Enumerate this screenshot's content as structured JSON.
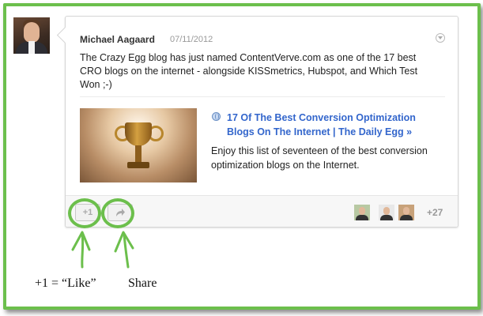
{
  "post": {
    "author": "Michael Aagaard",
    "date": "07/11/2012",
    "text": "The Crazy Egg blog has just named ContentVerve.com as one of the 17 best CRO blogs on the internet - alongside KISSmetrics, Hubspot, and Which Test Won ;-)"
  },
  "link_preview": {
    "title": "17 Of The Best Conversion Optimization Blogs On The Internet | The Daily Egg »",
    "description": "Enjoy this list of seventeen of the best conversion optimization blogs on the Internet."
  },
  "footer": {
    "plus_one_label": "+1",
    "plus_count": "+27"
  },
  "annotations": {
    "like_label": "+1  = “Like”",
    "share_label": "Share"
  },
  "colors": {
    "highlight": "#6cbf4c",
    "link": "#3366cc"
  },
  "icons": {
    "menu": "chevron-down-icon",
    "link": "globe-icon",
    "share": "share-arrow-icon"
  }
}
